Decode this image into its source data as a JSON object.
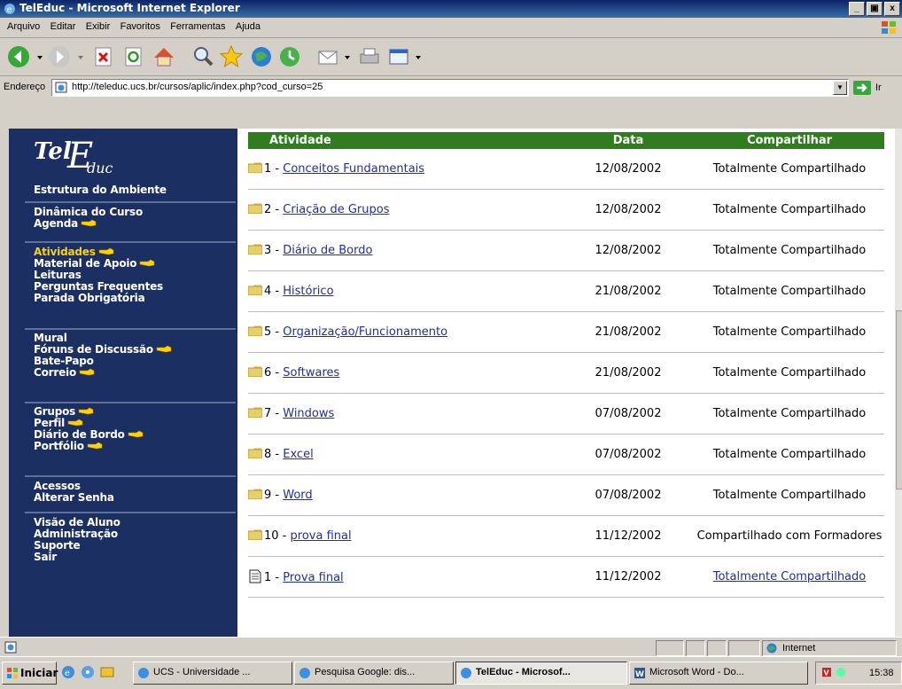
{
  "window": {
    "title": "TelEduc - Microsoft Internet Explorer"
  },
  "menu": [
    "Arquivo",
    "Editar",
    "Exibir",
    "Favoritos",
    "Ferramentas",
    "Ajuda"
  ],
  "address": {
    "label": "Endereço",
    "url": "http://teleduc.ucs.br/cursos/aplic/index.php?cod_curso=25",
    "go_label": "Ir"
  },
  "sidebar": {
    "groups": [
      [
        {
          "label": "Estrutura do Ambiente",
          "new": false,
          "active": false
        }
      ],
      [
        {
          "label": "Dinâmica do Curso",
          "new": false,
          "active": false
        },
        {
          "label": "Agenda",
          "new": true,
          "active": false
        }
      ],
      [
        {
          "label": "Atividades",
          "new": true,
          "active": true
        },
        {
          "label": "Material de Apoio",
          "new": true,
          "active": false
        },
        {
          "label": "Leituras",
          "new": false,
          "active": false
        },
        {
          "label": "Perguntas Frequentes",
          "new": false,
          "active": false
        },
        {
          "label": "Parada Obrigatória",
          "new": false,
          "active": false
        }
      ],
      [
        {
          "label": "Mural",
          "new": false,
          "active": false
        },
        {
          "label": "Fóruns de Discussão",
          "new": true,
          "active": false
        },
        {
          "label": "Bate-Papo",
          "new": false,
          "active": false
        },
        {
          "label": "Correio",
          "new": true,
          "active": false
        }
      ],
      [
        {
          "label": "Grupos",
          "new": true,
          "active": false
        },
        {
          "label": "Perfil",
          "new": true,
          "active": false
        },
        {
          "label": "Diário de Bordo",
          "new": true,
          "active": false
        },
        {
          "label": "Portfólio",
          "new": true,
          "active": false
        }
      ],
      [
        {
          "label": "Acessos",
          "new": false,
          "active": false
        },
        {
          "label": "Alterar Senha",
          "new": false,
          "active": false
        }
      ],
      [
        {
          "label": "Visão de Aluno",
          "new": false,
          "active": false
        },
        {
          "label": "Administração",
          "new": false,
          "active": false
        },
        {
          "label": "Suporte",
          "new": false,
          "active": false
        },
        {
          "label": "Sair",
          "new": false,
          "active": false
        }
      ]
    ]
  },
  "table": {
    "headers": [
      "Atividade",
      "Data",
      "Compartilhar"
    ],
    "rows": [
      {
        "icon": "folder",
        "num": "1",
        "name": "Conceitos Fundamentais",
        "date": "12/08/2002",
        "share": "Totalmente Compartilhado",
        "share_link": false
      },
      {
        "icon": "folder",
        "num": "2",
        "name": "Criação de Grupos",
        "date": "12/08/2002",
        "share": "Totalmente Compartilhado",
        "share_link": false
      },
      {
        "icon": "folder",
        "num": "3",
        "name": "Diário de Bordo",
        "date": "12/08/2002",
        "share": "Totalmente Compartilhado",
        "share_link": false
      },
      {
        "icon": "folder",
        "num": "4",
        "name": "Histórico",
        "date": "21/08/2002",
        "share": "Totalmente Compartilhado",
        "share_link": false
      },
      {
        "icon": "folder",
        "num": "5",
        "name": "Organização/Funcionamento",
        "date": "21/08/2002",
        "share": "Totalmente Compartilhado",
        "share_link": false
      },
      {
        "icon": "folder",
        "num": "6",
        "name": "Softwares",
        "date": "21/08/2002",
        "share": "Totalmente Compartilhado",
        "share_link": false
      },
      {
        "icon": "folder",
        "num": "7",
        "name": "Windows",
        "date": "07/08/2002",
        "share": "Totalmente Compartilhado",
        "share_link": false
      },
      {
        "icon": "folder",
        "num": "8",
        "name": "Excel",
        "date": "07/08/2002",
        "share": "Totalmente Compartilhado",
        "share_link": false
      },
      {
        "icon": "folder",
        "num": "9",
        "name": "Word",
        "date": "07/08/2002",
        "share": "Totalmente Compartilhado",
        "share_link": false
      },
      {
        "icon": "folder",
        "num": "10",
        "name": "prova final",
        "date": "11/12/2002",
        "share": "Compartilhado com Formadores",
        "share_link": false
      },
      {
        "icon": "document",
        "num": "1",
        "name": "Prova final",
        "date": "11/12/2002",
        "share": "Totalmente Compartilhado",
        "share_link": true
      }
    ]
  },
  "status": {
    "zone": "Internet"
  },
  "taskbar": {
    "start": "Iniciar",
    "tasks": [
      {
        "label": "UCS - Universidade ...",
        "active": false
      },
      {
        "label": "Pesquisa Google: dis...",
        "active": false
      },
      {
        "label": "TelEduc - Microsof...",
        "active": true
      },
      {
        "label": "Microsoft Word - Do...",
        "active": false
      }
    ],
    "clock": "15:38"
  },
  "colors": {
    "sidebar_bg": "#1b2f63",
    "header_green": "#2f7d1e",
    "active_nav": "#ffd200",
    "link": "#1e2fa4"
  }
}
